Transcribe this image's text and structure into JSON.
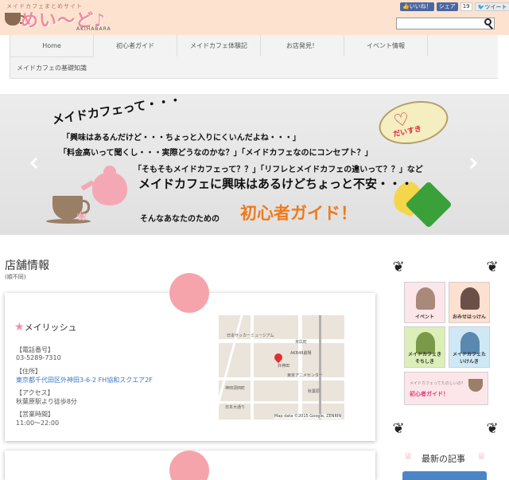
{
  "header": {
    "logo_sub": "メイドカフェまとめサイト",
    "logo_name": "めい〜ど♪",
    "logo_area": "AKIHABARA",
    "social": {
      "like_label": "いいね！",
      "share_label": "シェア",
      "share_count": "19",
      "tweet_label": "ツイート",
      "tweet_count": "2"
    },
    "search": {
      "placeholder": ""
    }
  },
  "nav": {
    "items": [
      {
        "label": "Home"
      },
      {
        "label": "初心者ガイド"
      },
      {
        "label": "メイドカフェ体験記"
      },
      {
        "label": "お店発見！"
      },
      {
        "label": "イベント情報"
      },
      {
        "label": "メイドカフェの基礎知識"
      }
    ]
  },
  "slider": {
    "heading": "メイドカフェって・・・",
    "line1": "「興味はあるんだけど・・・ちょっと入りにくいんだよね・・・」",
    "line2": "「料金高いって聞くし・・・実際どうなのかな？」「メイドカフェなのにコンセプト？」",
    "line3": "「そもそもメイドカフェって？？」「リフレとメイドカフェの違いって？？」など",
    "line4": "メイドカフェに興味はあるけどちょっと不安・・・",
    "line5": "そんなあなたのための",
    "line6": "初心者ガイド！",
    "badge_text": "だいすき",
    "colors": {
      "accent_orange": "#f07a1a",
      "heart_red": "#e0223a",
      "heart_green": "#3aa13a"
    }
  },
  "shop_section": {
    "title": "店舗情報",
    "subtitle": "(順不同)",
    "shops": [
      {
        "name": "メイリッシュ",
        "phone_label": "【電話番号】",
        "phone": "03-5289-7310",
        "address_label": "【住所】",
        "address": "東京都千代田区外神田3-6-2 FH協和スクエア2F",
        "access_label": "【アクセス】",
        "access": "秋葉原駅より徒歩8分",
        "hours_label": "【営業時間】",
        "hours": "11:00〜22:00",
        "map_credit": "Map data ©2015 Google, ZENRIN",
        "map_labels": [
          "日本サッカーミュージアム",
          "外神田",
          "AKB48劇場",
          "東京アニメセンター",
          "秋葉原",
          "神田須田町",
          "日本大通り",
          "末広町"
        ]
      }
    ]
  },
  "sidebar": {
    "banners": [
      {
        "label": "イベント"
      },
      {
        "label": "おみせはっけん"
      },
      {
        "label": "メイドカフェきそちしき"
      },
      {
        "label": "メイドカフェたいけんき"
      }
    ],
    "wide_banner": {
      "sub": "メイドカフェってたのしいの？",
      "label": "初心者ガイド！"
    },
    "latest_title": "最新の記事"
  }
}
